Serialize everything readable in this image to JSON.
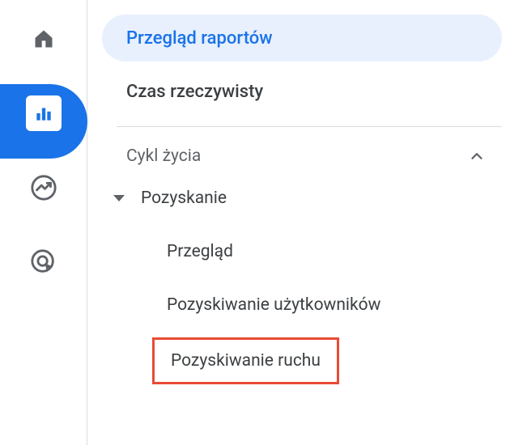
{
  "sidebar": {
    "reports_overview": "Przegląd raportów",
    "realtime": "Czas rzeczywisty",
    "section_lifecycle": "Cykl życia",
    "acquisition": "Pozyskanie",
    "overview": "Przegląd",
    "user_acquisition": "Pozyskiwanie użytkowników",
    "traffic_acquisition": "Pozyskiwanie ruchu"
  }
}
